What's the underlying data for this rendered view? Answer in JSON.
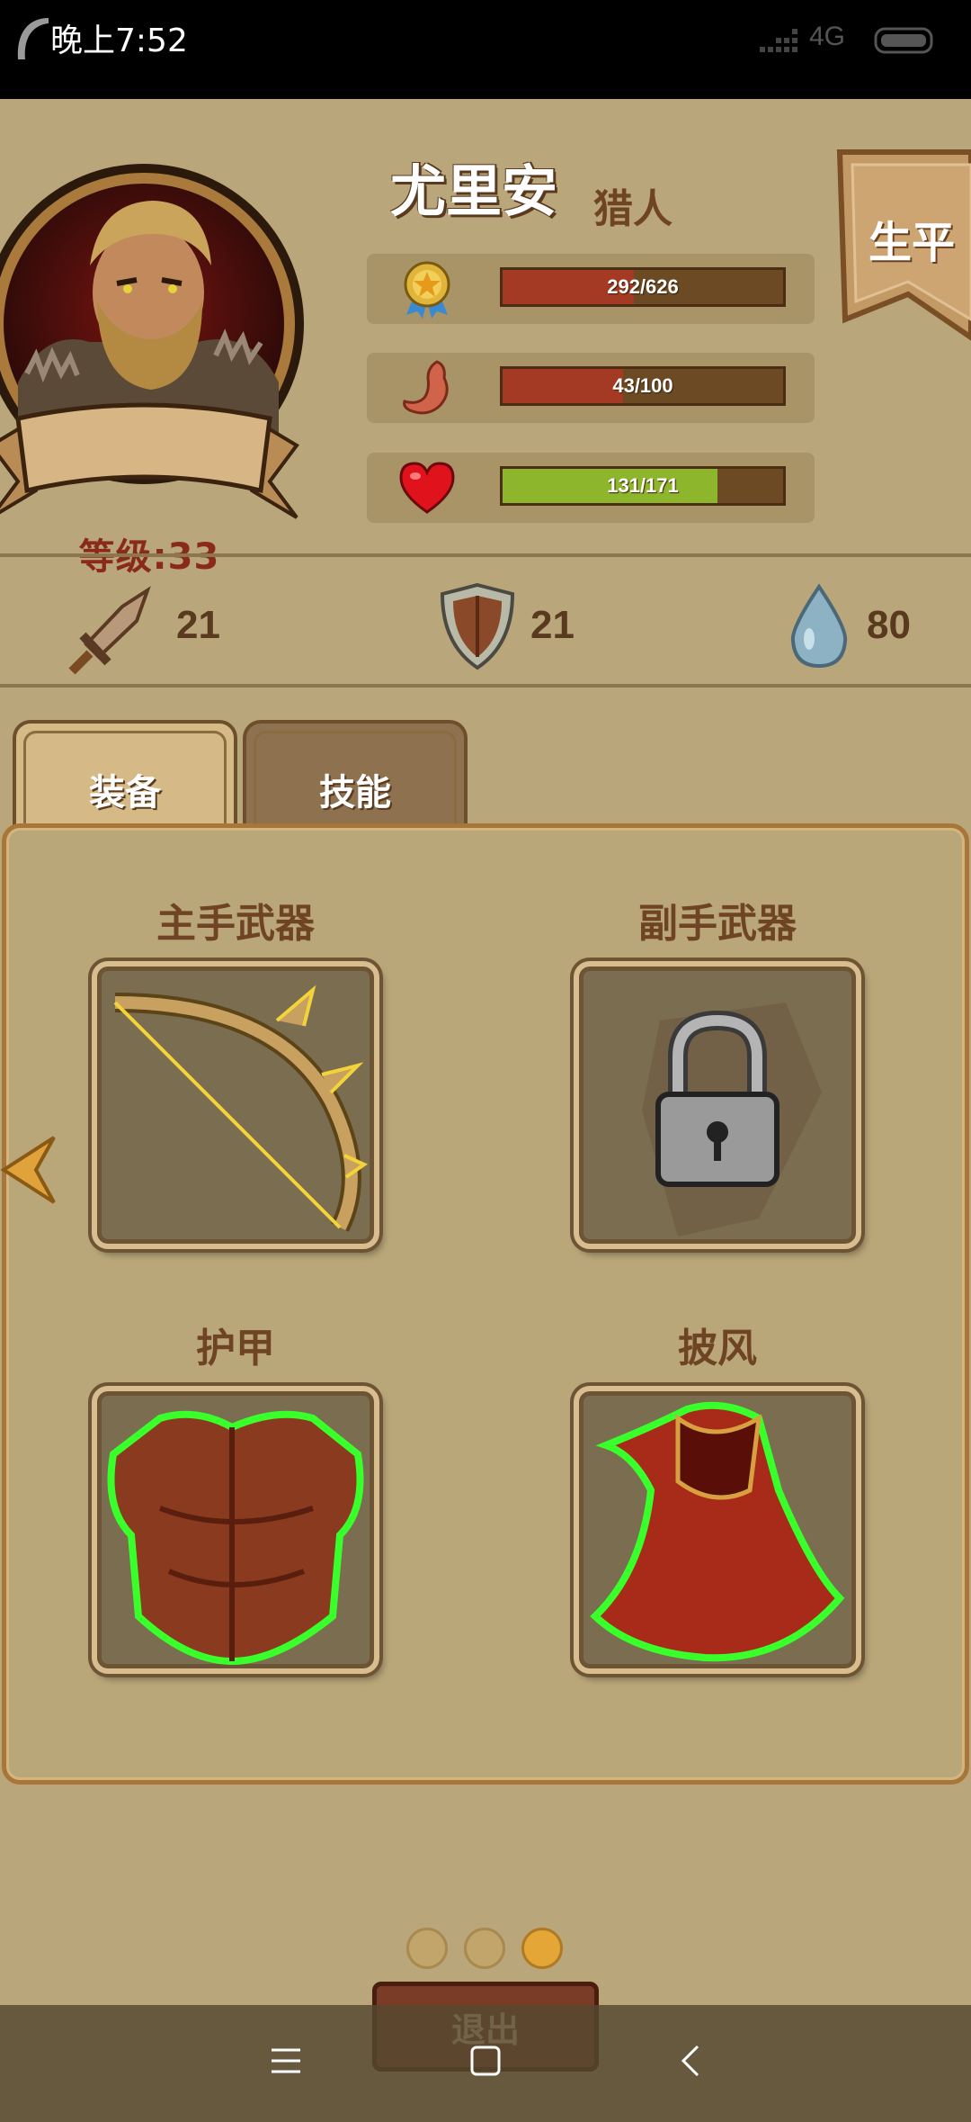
{
  "status_bar": {
    "time": "晚上7:52",
    "network": "4G"
  },
  "hero": {
    "name": "尤里安",
    "class": "猎人",
    "level_label": "等级:33"
  },
  "lifetime_button": "生平",
  "stats": {
    "experience": {
      "text": "292/626",
      "current": 292,
      "max": 626,
      "color": "#a43a23"
    },
    "hunger": {
      "text": "43/100",
      "current": 43,
      "max": 100,
      "color": "#a43a23"
    },
    "health": {
      "text": "131/171",
      "current": 131,
      "max": 171,
      "color": "#8eb62c"
    }
  },
  "attributes": {
    "attack": "21",
    "defense": "21",
    "water": "80"
  },
  "tabs": {
    "equipment": "装备",
    "skills": "技能"
  },
  "slots": {
    "main_weapon": "主手武器",
    "off_weapon": "副手武器",
    "armor": "护甲",
    "cloak": "披风"
  },
  "pagination": {
    "pages": 3,
    "active": 3
  },
  "exit_button": "退出"
}
